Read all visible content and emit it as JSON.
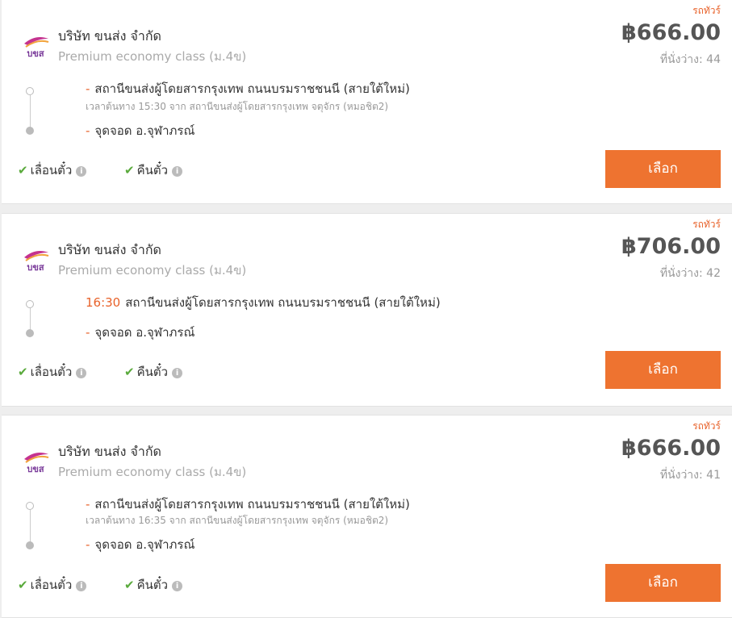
{
  "colors": {
    "accent": "#ee7330",
    "check": "#5aaa3c"
  },
  "cards": [
    {
      "company": "บริษัท ขนส่ง จำกัด",
      "class": "Premium economy class (ม.4ข)",
      "bus_type": "รถทัวร์",
      "price": "฿666.00",
      "seats": "ที่นั่งว่าง: 44",
      "departure_dash": "-",
      "departure": "สถานีขนส่งผู้โดยสารกรุงเทพ ถนนบรมราชชนนี (สายใต้ใหม่)",
      "departure_note": "เวลาต้นทาง 15:30  จาก สถานีขนส่งผู้โดยสารกรุงเทพ จตุจักร (หมอชิต2)",
      "arrival_dash": "-",
      "arrival": "จุดจอด อ.จุฬาภรณ์",
      "perk1": "เลื่อนตั๋ว",
      "perk2": "คืนตั๋ว",
      "button": "เลือก"
    },
    {
      "company": "บริษัท ขนส่ง จำกัด",
      "class": "Premium economy class (ม.4ข)",
      "bus_type": "รถทัวร์",
      "price": "฿706.00",
      "seats": "ที่นั่งว่าง: 42",
      "departure_time": "16:30",
      "departure": "สถานีขนส่งผู้โดยสารกรุงเทพ ถนนบรมราชชนนี (สายใต้ใหม่)",
      "arrival_dash": "-",
      "arrival": "จุดจอด อ.จุฬาภรณ์",
      "perk1": "เลื่อนตั๋ว",
      "perk2": "คืนตั๋ว",
      "button": "เลือก"
    },
    {
      "company": "บริษัท ขนส่ง จำกัด",
      "class": "Premium economy class (ม.4ข)",
      "bus_type": "รถทัวร์",
      "price": "฿666.00",
      "seats": "ที่นั่งว่าง: 41",
      "departure_dash": "-",
      "departure": "สถานีขนส่งผู้โดยสารกรุงเทพ ถนนบรมราชชนนี (สายใต้ใหม่)",
      "departure_note": "เวลาต้นทาง 16:35  จาก สถานีขนส่งผู้โดยสารกรุงเทพ จตุจักร (หมอชิต2)",
      "arrival_dash": "-",
      "arrival": "จุดจอด อ.จุฬาภรณ์",
      "perk1": "เลื่อนตั๋ว",
      "perk2": "คืนตั๋ว",
      "button": "เลือก"
    }
  ],
  "logo_text": "บขส",
  "info_glyph": "i",
  "check_glyph": "✔"
}
